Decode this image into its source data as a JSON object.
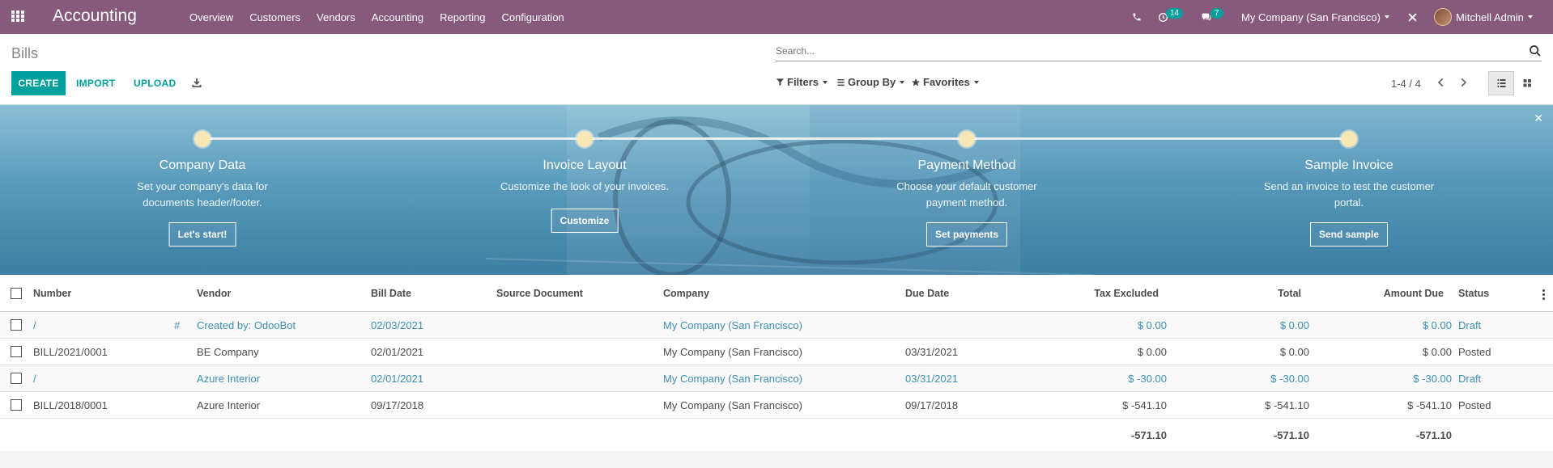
{
  "navbar": {
    "app_title": "Accounting",
    "menu": [
      "Overview",
      "Customers",
      "Vendors",
      "Accounting",
      "Reporting",
      "Configuration"
    ],
    "activity_count": "14",
    "message_count": "7",
    "company": "My Company (San Francisco)",
    "user": "Mitchell Admin"
  },
  "control": {
    "breadcrumb": "Bills",
    "search_placeholder": "Search...",
    "create_label": "CREATE",
    "import_label": "IMPORT",
    "upload_label": "UPLOAD",
    "filters_label": "Filters",
    "groupby_label": "Group By",
    "favorites_label": "Favorites",
    "pager": "1-4 / 4"
  },
  "banner": {
    "steps": [
      {
        "title": "Company Data",
        "desc": "Set your company's data for documents header/footer.",
        "button": "Let's start!"
      },
      {
        "title": "Invoice Layout",
        "desc": "Customize the look of your invoices.",
        "button": "Customize"
      },
      {
        "title": "Payment Method",
        "desc": "Choose your default customer payment method.",
        "button": "Set payments"
      },
      {
        "title": "Sample Invoice",
        "desc": "Send an invoice to test the customer portal.",
        "button": "Send sample"
      }
    ]
  },
  "table": {
    "headers": {
      "number": "Number",
      "vendor": "Vendor",
      "bill_date": "Bill Date",
      "source": "Source Document",
      "company": "Company",
      "due_date": "Due Date",
      "tax_excluded": "Tax Excluded",
      "total": "Total",
      "amount_due": "Amount Due",
      "status": "Status"
    },
    "rows": [
      {
        "number": "/",
        "hash": "#",
        "vendor": "Created by: OdooBot",
        "bill_date": "02/03/2021",
        "source": "",
        "company": "My Company (San Francisco)",
        "due_date": "",
        "tax_excluded": "$ 0.00",
        "total": "$ 0.00",
        "amount_due": "$ 0.00",
        "status": "Draft"
      },
      {
        "number": "BILL/2021/0001",
        "hash": "",
        "vendor": "BE Company",
        "bill_date": "02/01/2021",
        "source": "",
        "company": "My Company (San Francisco)",
        "due_date": "03/31/2021",
        "tax_excluded": "$ 0.00",
        "total": "$ 0.00",
        "amount_due": "$ 0.00",
        "status": "Posted"
      },
      {
        "number": "/",
        "hash": "",
        "vendor": "Azure Interior",
        "bill_date": "02/01/2021",
        "source": "",
        "company": "My Company (San Francisco)",
        "due_date": "03/31/2021",
        "tax_excluded": "$ -30.00",
        "total": "$ -30.00",
        "amount_due": "$ -30.00",
        "status": "Draft"
      },
      {
        "number": "BILL/2018/0001",
        "hash": "",
        "vendor": "Azure Interior",
        "bill_date": "09/17/2018",
        "source": "",
        "company": "My Company (San Francisco)",
        "due_date": "09/17/2018",
        "tax_excluded": "$ -541.10",
        "total": "$ -541.10",
        "amount_due": "$ -541.10",
        "status": "Posted"
      }
    ],
    "totals": {
      "tax_excluded": "-571.10",
      "total": "-571.10",
      "amount_due": "-571.10"
    }
  },
  "colors": {
    "brand": "#875a7b",
    "primary": "#00a09d",
    "link": "#3f8fb3"
  }
}
